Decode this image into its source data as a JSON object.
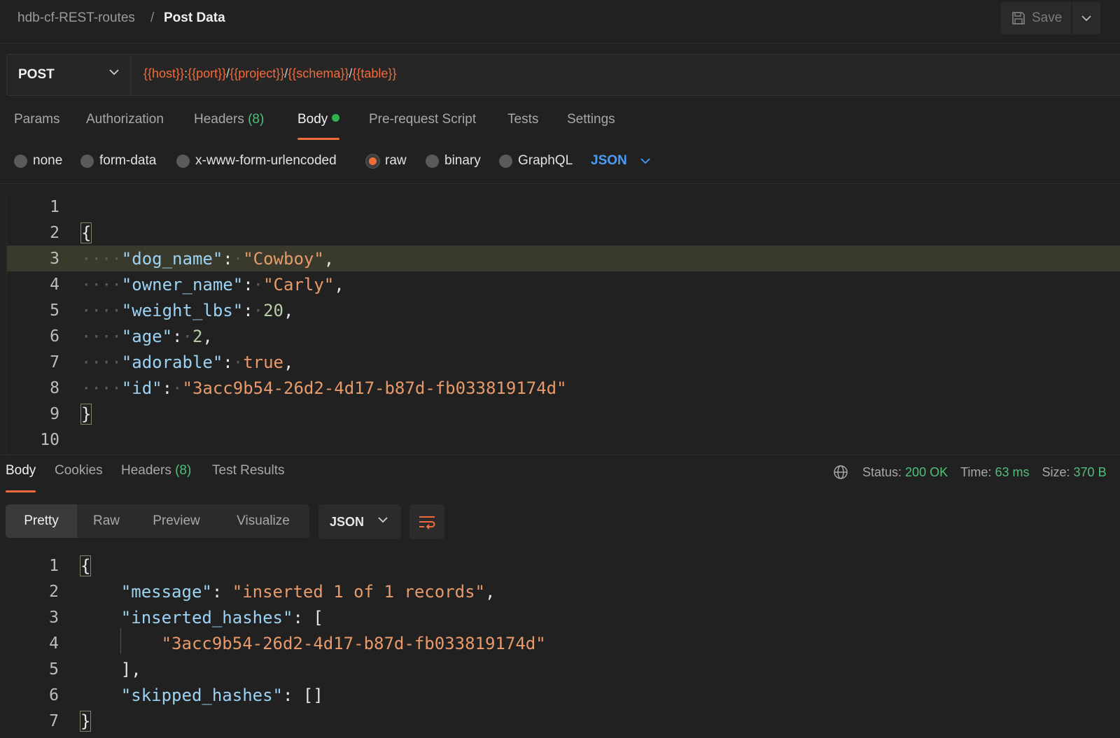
{
  "breadcrumb": {
    "collection": "hdb-cf-REST-routes",
    "separator": "/",
    "request": "Post Data"
  },
  "toolbar": {
    "save_label": "Save"
  },
  "request": {
    "method": "POST",
    "url_parts": [
      {
        "text": "{{host}}",
        "var": true
      },
      {
        "text": ":",
        "var": false
      },
      {
        "text": "{{port}}",
        "var": true
      },
      {
        "text": "/",
        "var": false
      },
      {
        "text": "{{project}}",
        "var": true
      },
      {
        "text": "/",
        "var": false
      },
      {
        "text": "{{schema}}",
        "var": true
      },
      {
        "text": "/",
        "var": false
      },
      {
        "text": "{{table}}",
        "var": true
      }
    ]
  },
  "request_tabs": {
    "params": "Params",
    "authorization": "Authorization",
    "headers": "Headers",
    "headers_count": "(8)",
    "body": "Body",
    "prerequest": "Pre-request Script",
    "tests": "Tests",
    "settings": "Settings"
  },
  "body_types": {
    "none": "none",
    "form_data": "form-data",
    "urlencoded": "x-www-form-urlencoded",
    "raw": "raw",
    "binary": "binary",
    "graphql": "GraphQL",
    "selected": "raw",
    "language": "JSON"
  },
  "request_body": {
    "line_numbers": [
      "1",
      "2",
      "3",
      "4",
      "5",
      "6",
      "7",
      "8",
      "9",
      "10"
    ],
    "fields": [
      {
        "key": "\"dog_name\"",
        "value": "\"Cowboy\"",
        "type": "string"
      },
      {
        "key": "\"owner_name\"",
        "value": "\"Carly\"",
        "type": "string"
      },
      {
        "key": "\"weight_lbs\"",
        "value": "20",
        "type": "number"
      },
      {
        "key": "\"age\"",
        "value": "2",
        "type": "number"
      },
      {
        "key": "\"adorable\"",
        "value": "true",
        "type": "bool"
      },
      {
        "key": "\"id\"",
        "value": "\"3acc9b54-26d2-4d17-b87d-fb033819174d\"",
        "type": "string"
      }
    ],
    "open_brace": "{",
    "close_brace": "}"
  },
  "response_tabs": {
    "body": "Body",
    "cookies": "Cookies",
    "headers": "Headers",
    "headers_count": "(8)",
    "test_results": "Test Results"
  },
  "response_meta": {
    "status_label": "Status:",
    "status_value": "200 OK",
    "time_label": "Time:",
    "time_value": "63 ms",
    "size_label": "Size:",
    "size_value": "370 B"
  },
  "response_view": {
    "pretty": "Pretty",
    "raw": "Raw",
    "preview": "Preview",
    "visualize": "Visualize",
    "language": "JSON"
  },
  "response_body": {
    "line_numbers": [
      "1",
      "2",
      "3",
      "4",
      "5",
      "6",
      "7"
    ],
    "open_brace": "{",
    "message_key": "\"message\"",
    "message_value": "\"inserted 1 of 1 records\"",
    "inserted_key": "\"inserted_hashes\"",
    "inserted_value": "\"3acc9b54-26d2-4d17-b87d-fb033819174d\"",
    "skipped_key": "\"skipped_hashes\"",
    "skipped_value": "[]",
    "close_bracket": "],",
    "close_brace": "}"
  },
  "colors": {
    "accent": "#f26b3a",
    "success": "#4fc07a",
    "link": "#4d9bf5",
    "background": "#212121"
  }
}
